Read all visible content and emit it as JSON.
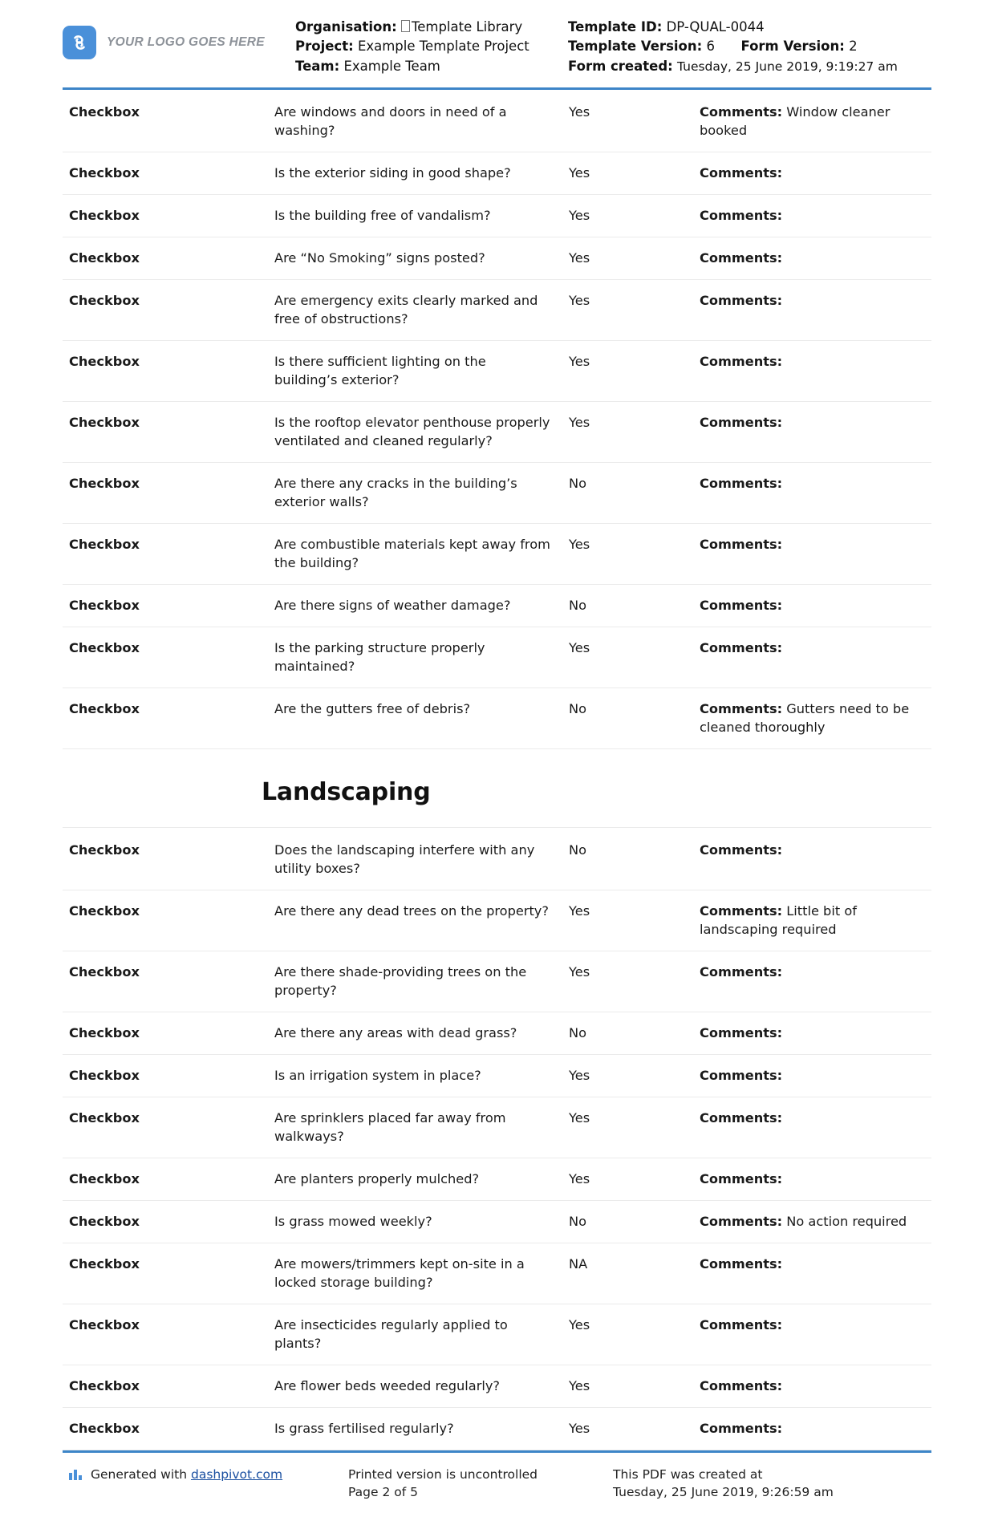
{
  "header": {
    "logo_text": "YOUR LOGO GOES HERE",
    "logo_icon": "dashpivot-logo-icon",
    "organisation_label": "Organisation:",
    "organisation_value": "Template Library",
    "project_label": "Project:",
    "project_value": "Example Template Project",
    "team_label": "Team:",
    "team_value": "Example Team",
    "template_id_label": "Template ID:",
    "template_id_value": "DP-QUAL-0044",
    "template_version_label": "Template Version:",
    "template_version_value": "6",
    "form_version_label": "Form Version:",
    "form_version_value": "2",
    "form_created_label": "Form created:",
    "form_created_value": "Tuesday, 25 June 2019, 9:19:27 am"
  },
  "rows": [
    {
      "type": "Checkbox",
      "question": "Are windows and doors in need of a washing?",
      "answer": "Yes",
      "comments_label": "Comments:",
      "comments_value": "Window cleaner booked"
    },
    {
      "type": "Checkbox",
      "question": "Is the exterior siding in good shape?",
      "answer": "Yes",
      "comments_label": "Comments:",
      "comments_value": ""
    },
    {
      "type": "Checkbox",
      "question": "Is the building free of vandalism?",
      "answer": "Yes",
      "comments_label": "Comments:",
      "comments_value": ""
    },
    {
      "type": "Checkbox",
      "question": "Are “No Smoking” signs posted?",
      "answer": "Yes",
      "comments_label": "Comments:",
      "comments_value": ""
    },
    {
      "type": "Checkbox",
      "question": "Are emergency exits clearly marked and free of obstructions?",
      "answer": "Yes",
      "comments_label": "Comments:",
      "comments_value": ""
    },
    {
      "type": "Checkbox",
      "question": "Is there sufficient lighting on the building’s exterior?",
      "answer": "Yes",
      "comments_label": "Comments:",
      "comments_value": ""
    },
    {
      "type": "Checkbox",
      "question": "Is the rooftop elevator penthouse properly ventilated and cleaned regularly?",
      "answer": "Yes",
      "comments_label": "Comments:",
      "comments_value": ""
    },
    {
      "type": "Checkbox",
      "question": "Are there any cracks in the building’s exterior walls?",
      "answer": "No",
      "comments_label": "Comments:",
      "comments_value": ""
    },
    {
      "type": "Checkbox",
      "question": "Are combustible materials kept away from the building?",
      "answer": "Yes",
      "comments_label": "Comments:",
      "comments_value": ""
    },
    {
      "type": "Checkbox",
      "question": "Are there signs of weather damage?",
      "answer": "No",
      "comments_label": "Comments:",
      "comments_value": ""
    },
    {
      "type": "Checkbox",
      "question": "Is the parking structure properly maintained?",
      "answer": "Yes",
      "comments_label": "Comments:",
      "comments_value": ""
    },
    {
      "type": "Checkbox",
      "question": "Are the gutters free of debris?",
      "answer": "No",
      "comments_label": "Comments:",
      "comments_value": "Gutters need to be cleaned thoroughly"
    }
  ],
  "section": {
    "title": "Landscaping"
  },
  "rows2": [
    {
      "type": "Checkbox",
      "question": "Does the landscaping interfere with any utility boxes?",
      "answer": "No",
      "comments_label": "Comments:",
      "comments_value": ""
    },
    {
      "type": "Checkbox",
      "question": "Are there any dead trees on the property?",
      "answer": "Yes",
      "comments_label": "Comments:",
      "comments_value": "Little bit of landscaping required"
    },
    {
      "type": "Checkbox",
      "question": "Are there shade-providing trees on the property?",
      "answer": "Yes",
      "comments_label": "Comments:",
      "comments_value": ""
    },
    {
      "type": "Checkbox",
      "question": "Are there any areas with dead grass?",
      "answer": "No",
      "comments_label": "Comments:",
      "comments_value": ""
    },
    {
      "type": "Checkbox",
      "question": "Is an irrigation system in place?",
      "answer": "Yes",
      "comments_label": "Comments:",
      "comments_value": ""
    },
    {
      "type": "Checkbox",
      "question": "Are sprinklers placed far away from walkways?",
      "answer": "Yes",
      "comments_label": "Comments:",
      "comments_value": ""
    },
    {
      "type": "Checkbox",
      "question": "Are planters properly mulched?",
      "answer": "Yes",
      "comments_label": "Comments:",
      "comments_value": ""
    },
    {
      "type": "Checkbox",
      "question": "Is grass mowed weekly?",
      "answer": "No",
      "comments_label": "Comments:",
      "comments_value": "No action required"
    },
    {
      "type": "Checkbox",
      "question": "Are mowers/trimmers kept on-site in a locked storage building?",
      "answer": "NA",
      "comments_label": "Comments:",
      "comments_value": ""
    },
    {
      "type": "Checkbox",
      "question": "Are insecticides regularly applied to plants?",
      "answer": "Yes",
      "comments_label": "Comments:",
      "comments_value": ""
    },
    {
      "type": "Checkbox",
      "question": "Are flower beds weeded regularly?",
      "answer": "Yes",
      "comments_label": "Comments:",
      "comments_value": ""
    },
    {
      "type": "Checkbox",
      "question": "Is grass fertilised regularly?",
      "answer": "Yes",
      "comments_label": "Comments:",
      "comments_value": ""
    }
  ],
  "footer": {
    "generated_prefix": "Generated with",
    "generated_link": "dashpivot.com",
    "printed_line1": "Printed version is uncontrolled",
    "printed_line2": "Page 2 of 5",
    "created_line1": "This PDF was created at",
    "created_line2": "Tuesday, 25 June 2019, 9:26:59 am"
  },
  "colors": {
    "accent": "#3d85c8",
    "logo_blue": "#4a90d9",
    "link": "#1a4fa0",
    "row_divider": "#ebebeb"
  }
}
